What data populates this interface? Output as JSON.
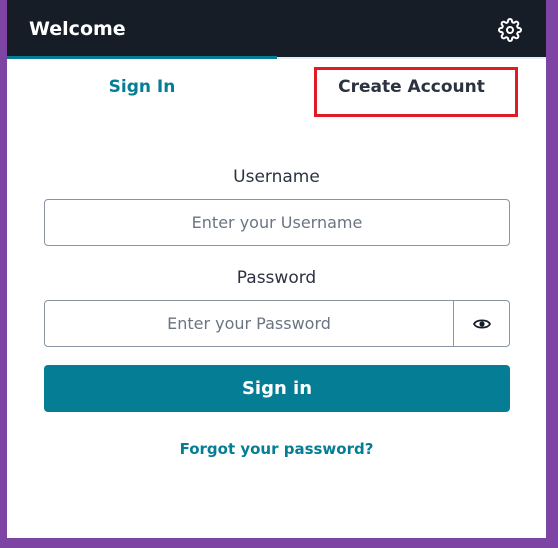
{
  "header": {
    "title": "Welcome",
    "settings_icon": "gear-icon"
  },
  "tabs": [
    {
      "label": "Sign In",
      "active": true
    },
    {
      "label": "Create Account",
      "active": false,
      "highlighted": true
    }
  ],
  "form": {
    "username_label": "Username",
    "username_placeholder": "Enter your Username",
    "username_value": "",
    "password_label": "Password",
    "password_placeholder": "Enter your Password",
    "password_value": "",
    "show_password_icon": "eye-icon",
    "submit_label": "Sign in",
    "forgot_link": "Forgot your password?"
  },
  "colors": {
    "accent": "#047d95",
    "header_bg": "#161d27",
    "page_bg": "#7e44a3",
    "highlight": "#e01b24"
  }
}
